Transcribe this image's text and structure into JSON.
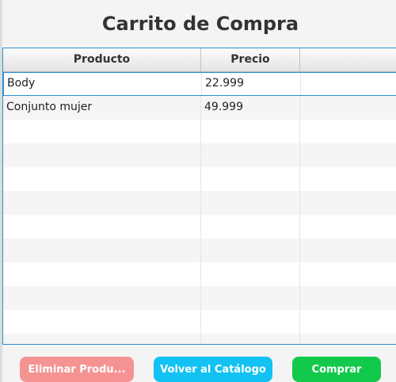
{
  "title": "Carrito de Compra",
  "table": {
    "columns": [
      "Producto",
      "Precio",
      ""
    ],
    "rows": [
      {
        "producto": "Body",
        "precio": "22.999"
      },
      {
        "producto": "Conjunto mujer",
        "precio": "49.999"
      }
    ]
  },
  "buttons": {
    "remove_label": "Eliminar Produ...",
    "back_label": "Volver al Catálogo",
    "buy_label": "Comprar"
  },
  "colors": {
    "remove": "#f59393",
    "back": "#12c2f2",
    "buy": "#13c94b",
    "selection": "#2b8fd6"
  }
}
